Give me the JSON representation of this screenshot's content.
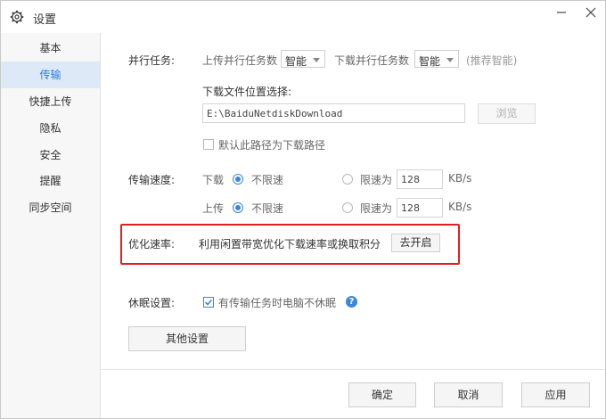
{
  "window": {
    "title": "设置"
  },
  "sidebar": {
    "items": [
      {
        "label": "基本"
      },
      {
        "label": "传输"
      },
      {
        "label": "快捷上传"
      },
      {
        "label": "隐私"
      },
      {
        "label": "安全"
      },
      {
        "label": "提醒"
      },
      {
        "label": "同步空间"
      }
    ],
    "active_index": 1
  },
  "parallel": {
    "section_label": "并行任务:",
    "upload_label": "上传并行任务数",
    "upload_value": "智能",
    "download_label": "下载并行任务数",
    "download_value": "智能",
    "hint": "(推荐智能)"
  },
  "location": {
    "label": "下载文件位置选择:",
    "path": "E:\\BaiduNetdiskDownload",
    "browse_label": "浏览",
    "default_checkbox_label": "默认此路径为下载路径",
    "default_checked": false
  },
  "speed": {
    "section_label": "传输速度:",
    "download": {
      "label": "下载",
      "unlimited_label": "不限速",
      "limit_label": "限速为",
      "limit_value": "128",
      "unit": "KB/s",
      "selected": "unlimited"
    },
    "upload": {
      "label": "上传",
      "unlimited_label": "不限速",
      "limit_label": "限速为",
      "limit_value": "128",
      "unit": "KB/s",
      "selected": "unlimited"
    }
  },
  "optimize": {
    "section_label": "优化速率:",
    "description": "利用闲置带宽优化下载速率或换取积分",
    "button_label": "去开启",
    "highlight_color": "#e02020"
  },
  "sleep": {
    "section_label": "休眠设置:",
    "checkbox_label": "有传输任务时电脑不休眠",
    "checked": true,
    "help_icon": "help-icon"
  },
  "other_settings_label": "其他设置",
  "footer": {
    "ok_label": "确定",
    "cancel_label": "取消",
    "apply_label": "应用"
  },
  "colors": {
    "accent": "#3a86df",
    "active_bg": "#dde9f6",
    "active_text": "#2a7ce0"
  }
}
